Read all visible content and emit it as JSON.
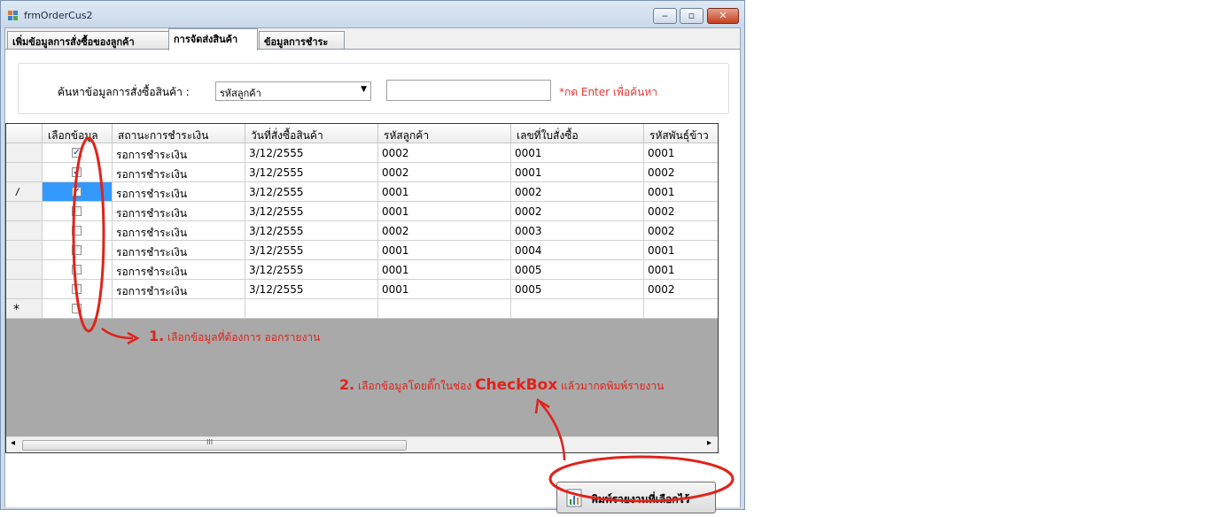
{
  "window": {
    "title": "frmOrderCus2"
  },
  "tabs": [
    {
      "label": "เพิ่มข้อมูลการสั่งซื้อของลูกค้า",
      "active": false
    },
    {
      "label": "การจัดส่งสินค้า",
      "active": true
    },
    {
      "label": "ข้อมูลการชำระ",
      "active": false
    }
  ],
  "search": {
    "label": "ค้นหาข้อมูลการสั่งซื้อสินค้า :",
    "combo_value": "รหัสลูกค้า",
    "input_value": "",
    "hint": "*กด Enter เพื่อค้นหา"
  },
  "grid": {
    "columns": [
      "เลือกข้อมูล",
      "สถานะการชำระเงิน",
      "วันที่สั่งซื้อสินค้า",
      "รหัสลูกค้า",
      "เลขที่ใบสั่งซื้อ",
      "รหัสพันธุ์ข้าว"
    ],
    "rows": [
      {
        "checked": true,
        "status": "รอการชำระเงิน",
        "date": "3/12/2555",
        "customer": "0002",
        "order": "0001",
        "rice": "0001"
      },
      {
        "checked": true,
        "status": "รอการชำระเงิน",
        "date": "3/12/2555",
        "customer": "0002",
        "order": "0001",
        "rice": "0002"
      },
      {
        "checked": true,
        "status": "รอการชำระเงิน",
        "date": "3/12/2555",
        "customer": "0001",
        "order": "0002",
        "rice": "0001"
      },
      {
        "checked": false,
        "status": "รอการชำระเงิน",
        "date": "3/12/2555",
        "customer": "0001",
        "order": "0002",
        "rice": "0002"
      },
      {
        "checked": false,
        "status": "รอการชำระเงิน",
        "date": "3/12/2555",
        "customer": "0002",
        "order": "0003",
        "rice": "0002"
      },
      {
        "checked": false,
        "status": "รอการชำระเงิน",
        "date": "3/12/2555",
        "customer": "0001",
        "order": "0004",
        "rice": "0001"
      },
      {
        "checked": false,
        "status": "รอการชำระเงิน",
        "date": "3/12/2555",
        "customer": "0001",
        "order": "0005",
        "rice": "0001"
      },
      {
        "checked": false,
        "status": "รอการชำระเงิน",
        "date": "3/12/2555",
        "customer": "0001",
        "order": "0005",
        "rice": "0002"
      }
    ],
    "editing_row_marker": "𝑙",
    "new_row_marker": "*",
    "scroll_thumb_glyph": "III",
    "scroll_left": "◂",
    "scroll_right": "▸"
  },
  "print_button": {
    "label": "พิมพ์รายงานที่เลือกไว้"
  },
  "annotations": {
    "step1_num": "1.",
    "step1_text": "เลือกข้อมูลที่ต้องการ ออกรายงาน",
    "step2_num": "2.",
    "step2_text_a": "เลือกข้อมูลโดยติ๊กในช่อง",
    "step2_keyword": "CheckBox",
    "step2_text_b": "แล้วมากดพิมพ์รายงาน",
    "color": "#e0231b"
  },
  "colors": {
    "selection": "#3399ff",
    "grid_background": "#a9a9a9",
    "hint": "#e33636"
  }
}
